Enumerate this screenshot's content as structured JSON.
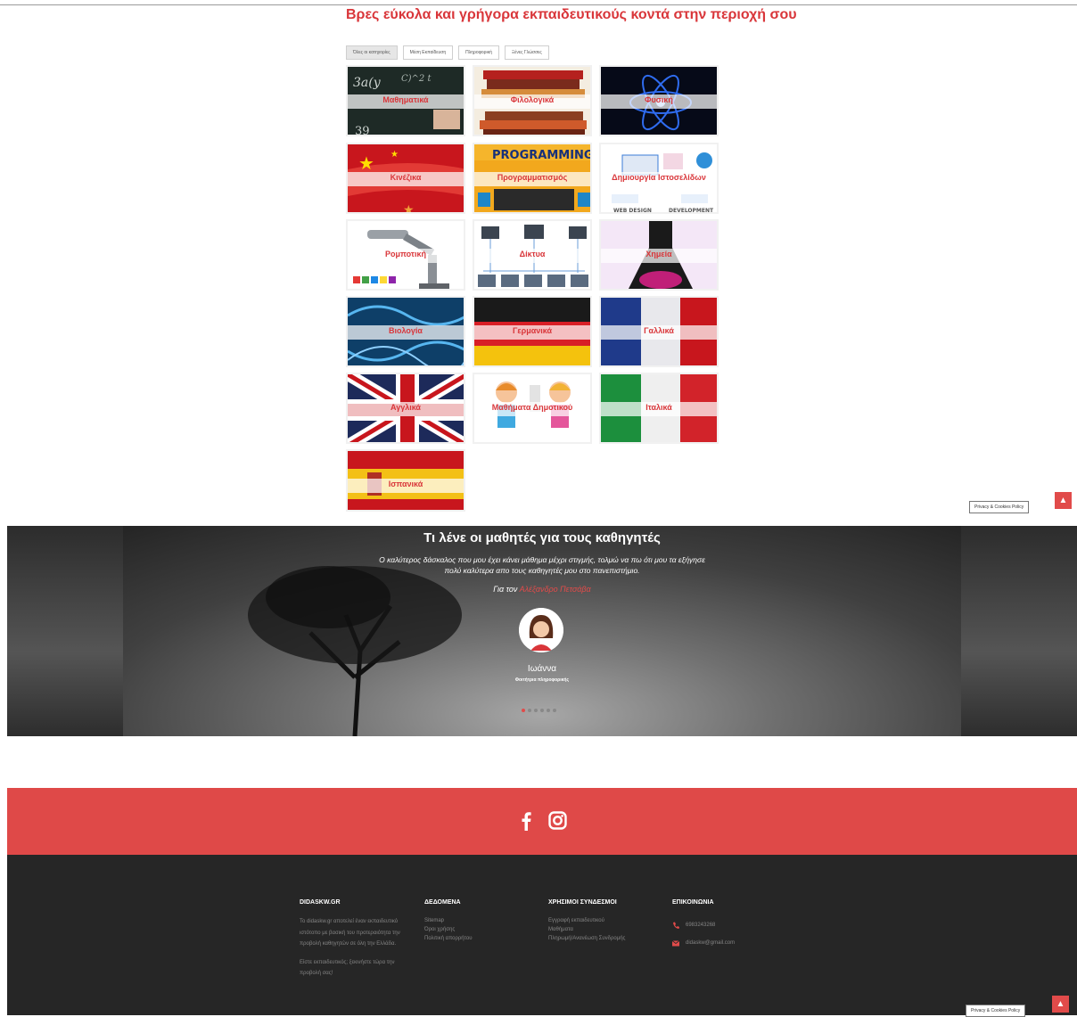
{
  "page": {
    "headline": "Βρες εύκολα και γρήγορα εκπαιδευτικούς κοντά στην περιοχή σου",
    "filters": [
      "Όλες οι κατηγορίες",
      "Μέση Εκπαίδευση",
      "Πληροφορική",
      "Ξένες Γλώσσες"
    ]
  },
  "categories": [
    {
      "label": "Μαθηματικά",
      "icon": "chalkboard-photo"
    },
    {
      "label": "Φιλολογικά",
      "icon": "books-photo"
    },
    {
      "label": "Φυσική",
      "icon": "atom-photo"
    },
    {
      "label": "Κινέζικα",
      "icon": "china-flag-photo"
    },
    {
      "label": "Προγραμματισμός",
      "icon": "programming-photo"
    },
    {
      "label": "Δημιουργία Ιστοσελίδων",
      "icon": "web-design-photo",
      "caption_left": "WEB DESIGN",
      "caption_right": "DEVELOPMENT"
    },
    {
      "label": "Ρομποτική",
      "icon": "robot-arm-photo"
    },
    {
      "label": "Δίκτυα",
      "icon": "network-photo"
    },
    {
      "label": "Χημεία",
      "icon": "flask-photo"
    },
    {
      "label": "Βιολογία",
      "icon": "dna-photo"
    },
    {
      "label": "Γερμανικά",
      "icon": "germany-flag-photo"
    },
    {
      "label": "Γαλλικά",
      "icon": "france-flag-photo"
    },
    {
      "label": "Αγγλικά",
      "icon": "uk-flag-photo"
    },
    {
      "label": "Μαθήματα Δημοτικού",
      "icon": "kids-photo"
    },
    {
      "label": "Ιταλικά",
      "icon": "italy-flag-photo"
    },
    {
      "label": "Ισπανικά",
      "icon": "spain-flag-photo"
    }
  ],
  "widgets": {
    "privacy": "Privacy & Cookies Policy",
    "to_top_icon": "chevron-up-icon"
  },
  "testimonial": {
    "title": "Τι λένε οι μαθητές για τους καθηγητές",
    "quote": "Ο καλύτερος δάσκαλος που μου έχει κάνει μάθημα μέχρι στιγμής, τολμώ να πω ότι μου τα εξήγησε πολύ καλύτερα απο τους καθηγητές μου στο πανεπιστήμιο.",
    "for_prefix": "Για τον",
    "teacher": "Αλέξανδρο Πετσάβα",
    "student_name": "Ιωάννα",
    "student_role": "Φοιτήτρια πληροφορικής",
    "dots": 6,
    "active_dot": 0
  },
  "social": {
    "icons": [
      "facebook-icon",
      "instagram-icon"
    ]
  },
  "footer": {
    "col1": {
      "title": "DIDASKW.GR",
      "text1": "Το didaskw.gr αποτελεί έναν εκπαιδευτικό ιστότοπο με βασική του προτεραιότητα την προβολή καθηγητών σε όλη την Ελλάδα.",
      "text2": "Είστε εκπαιδευτικός; ξεκινήστε τώρα την προβολή σας!"
    },
    "col2": {
      "title": "ΔΕΔΟΜΕΝΑ",
      "links": [
        "Sitemap",
        "Όροι χρήσης",
        "Πολιτική απορρήτου"
      ]
    },
    "col3": {
      "title": "ΧΡΗΣΙΜΟΙ ΣΥΝΔΕΣΜΟΙ",
      "links": [
        "Εγγραφή εκπαιδευτικού",
        "Μαθήματα",
        "Πληρωμή/Ανανέωση Συνδρομής"
      ]
    },
    "col4": {
      "title": "ΕΠΙΚΟΙΝΩΝΙΑ",
      "phone": "6983243268",
      "email": "didaskw@gmail.com"
    }
  },
  "colors": {
    "accent": "#d9363a",
    "social_bar": "#df4948",
    "footer_bg": "#262626"
  }
}
